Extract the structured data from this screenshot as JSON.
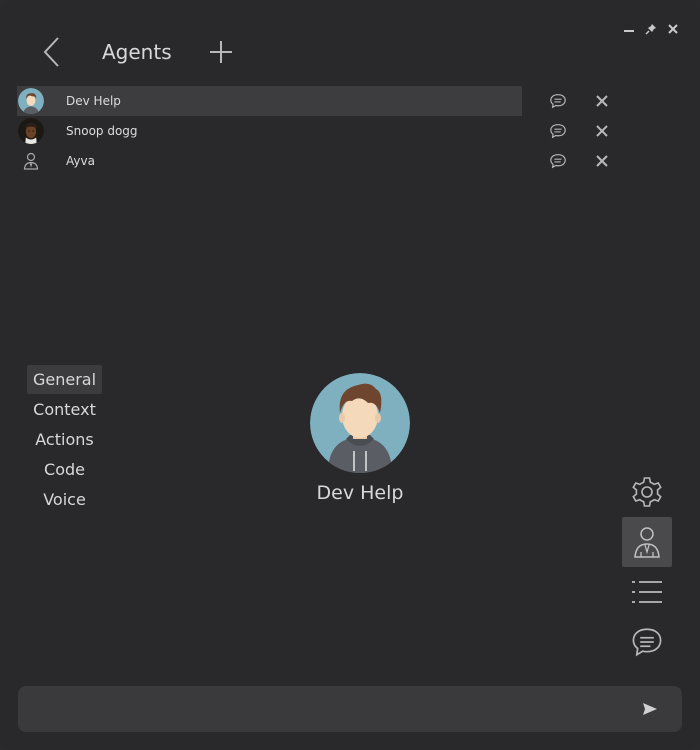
{
  "header": {
    "title": "Agents"
  },
  "agents": [
    {
      "name": "Dev Help",
      "selected": true,
      "avatar": "cartoon-man-hoodie"
    },
    {
      "name": "Snoop dogg",
      "selected": false,
      "avatar": "photo-snoop-dogg"
    },
    {
      "name": "Ayva",
      "selected": false,
      "avatar": "person-outline-icon"
    }
  ],
  "tabs": [
    "General",
    "Context",
    "Actions",
    "Code",
    "Voice"
  ],
  "active_tab": "General",
  "profile": {
    "name": "Dev Help"
  },
  "side_nav": [
    "settings-gear-icon",
    "agent-person-icon",
    "list-icon",
    "chat-bubble-icon"
  ],
  "active_side_nav": "agent-person-icon",
  "input": {
    "value": "",
    "placeholder": ""
  },
  "colors": {
    "background": "#29292b",
    "selected_row": "#3d3d3f",
    "input_bar": "#3a3a3c",
    "icon": "#c8c8c8"
  }
}
